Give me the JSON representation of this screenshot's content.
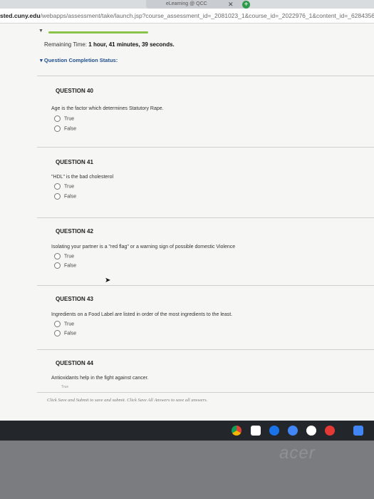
{
  "browser": {
    "tab_title": "eLearning @ QCC",
    "url_domain": "sted.cuny.edu",
    "url_path": "/webapps/assessment/take/launch.jsp?course_assessment_id=_2081023_1&course_id=_2022976_1&content_id=_62843567_1"
  },
  "timer": {
    "label": "Remaining Time:",
    "value": "1 hour, 41 minutes, 39 seconds."
  },
  "completion_status": "Question Completion Status:",
  "questions": [
    {
      "number": "QUESTION 40",
      "text": "Age is the factor which determines Statutory Rape.",
      "options": [
        "True",
        "False"
      ]
    },
    {
      "number": "QUESTION 41",
      "text": "\"HDL\" is the bad cholesterol",
      "options": [
        "True",
        "False"
      ]
    },
    {
      "number": "QUESTION 42",
      "text": "Isolating your partner is a \"red flag\" or a warning sign of possible domestic Violence",
      "options": [
        "True",
        "False"
      ]
    },
    {
      "number": "QUESTION 43",
      "text": "Ingredients on a Food Label are listed in order of the most ingredients to the least.",
      "options": [
        "True",
        "False"
      ]
    },
    {
      "number": "QUESTION 44",
      "text": "Antioxidants help in the fight against cancer.",
      "options": [
        "True"
      ]
    }
  ],
  "footer_note": "Click Save and Submit to save and submit. Click Save All Answers to save all answers.",
  "taskbar_icons": [
    "chrome-icon",
    "gmail-icon",
    "files-icon",
    "play-store-icon",
    "youtube-icon",
    "settings-icon",
    "docs-icon"
  ],
  "brand": "acer",
  "colors": {
    "accent_green": "#8bc34a",
    "link_blue": "#1f4f8f"
  }
}
